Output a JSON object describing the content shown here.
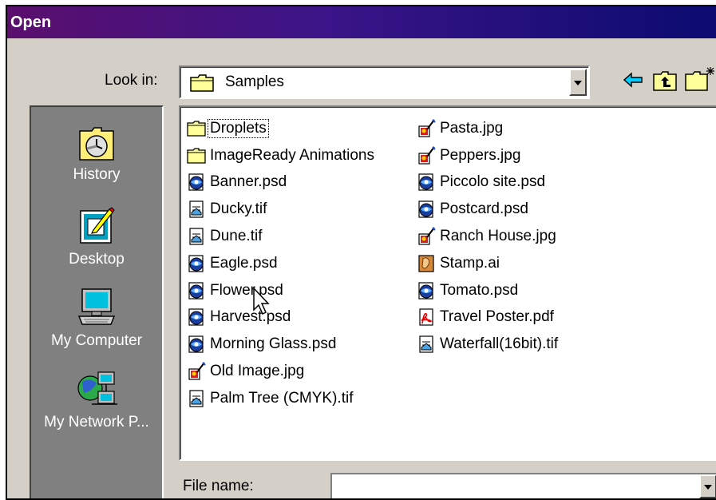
{
  "window": {
    "title": "Open"
  },
  "lookin": {
    "label": "Look in:",
    "value": "Samples"
  },
  "places": [
    {
      "label": "History",
      "icon": "history-icon"
    },
    {
      "label": "Desktop",
      "icon": "desktop-icon"
    },
    {
      "label": "My Computer",
      "icon": "my-computer-icon"
    },
    {
      "label": "My Network P...",
      "icon": "network-places-icon"
    }
  ],
  "files_col1": [
    {
      "name": "Droplets",
      "type": "folder"
    },
    {
      "name": "ImageReady Animations",
      "type": "folder"
    },
    {
      "name": "Banner.psd",
      "type": "psd"
    },
    {
      "name": "Ducky.tif",
      "type": "tif"
    },
    {
      "name": "Dune.tif",
      "type": "tif"
    },
    {
      "name": "Eagle.psd",
      "type": "psd"
    },
    {
      "name": "Flower.psd",
      "type": "psd"
    },
    {
      "name": "Harvest.psd",
      "type": "psd"
    },
    {
      "name": "Morning Glass.psd",
      "type": "psd"
    },
    {
      "name": "Old Image.jpg",
      "type": "jpg"
    },
    {
      "name": "Palm Tree (CMYK).tif",
      "type": "tif"
    }
  ],
  "files_col2": [
    {
      "name": "Pasta.jpg",
      "type": "jpg"
    },
    {
      "name": "Peppers.jpg",
      "type": "jpg"
    },
    {
      "name": "Piccolo site.psd",
      "type": "psd"
    },
    {
      "name": "Postcard.psd",
      "type": "psd"
    },
    {
      "name": "Ranch House.jpg",
      "type": "jpg"
    },
    {
      "name": "Stamp.ai",
      "type": "ai"
    },
    {
      "name": "Tomato.psd",
      "type": "psd"
    },
    {
      "name": "Travel Poster.pdf",
      "type": "pdf"
    },
    {
      "name": "Waterfall(16bit).tif",
      "type": "tif"
    }
  ],
  "filename": {
    "label": "File name:",
    "value": ""
  }
}
